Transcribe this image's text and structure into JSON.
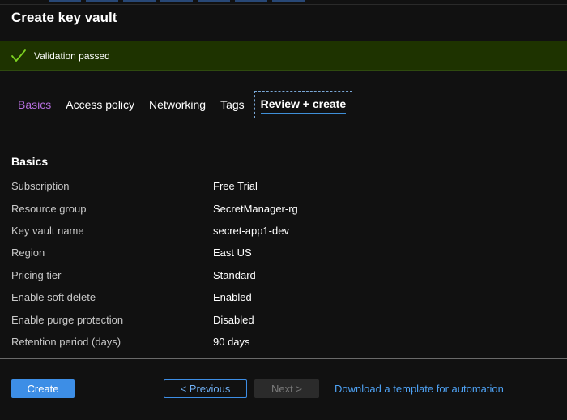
{
  "header": {
    "title": "Create key vault"
  },
  "banner": {
    "icon": "checkmark-icon",
    "text": "Validation passed",
    "background": "#1e3300",
    "icon_color": "#7ed321"
  },
  "tabs": [
    {
      "label": "Basics",
      "state": "visited"
    },
    {
      "label": "Access policy",
      "state": "normal"
    },
    {
      "label": "Networking",
      "state": "normal"
    },
    {
      "label": "Tags",
      "state": "normal"
    },
    {
      "label": "Review + create",
      "state": "active"
    }
  ],
  "summary": {
    "heading": "Basics",
    "rows": [
      {
        "label": "Subscription",
        "value": "Free Trial"
      },
      {
        "label": "Resource group",
        "value": "SecretManager-rg"
      },
      {
        "label": "Key vault name",
        "value": "secret-app1-dev"
      },
      {
        "label": "Region",
        "value": "East US"
      },
      {
        "label": "Pricing tier",
        "value": "Standard"
      },
      {
        "label": "Enable soft delete",
        "value": "Enabled"
      },
      {
        "label": "Enable purge protection",
        "value": "Disabled"
      },
      {
        "label": "Retention period (days)",
        "value": "90 days"
      }
    ]
  },
  "footer": {
    "create_label": "Create",
    "previous_label": "< Previous",
    "next_label": "Next >",
    "download_label": "Download a template for automation"
  },
  "colors": {
    "accent": "#3d8ee6",
    "link": "#4ea1f3",
    "visited_tab": "#b46edc",
    "background": "#111111"
  }
}
